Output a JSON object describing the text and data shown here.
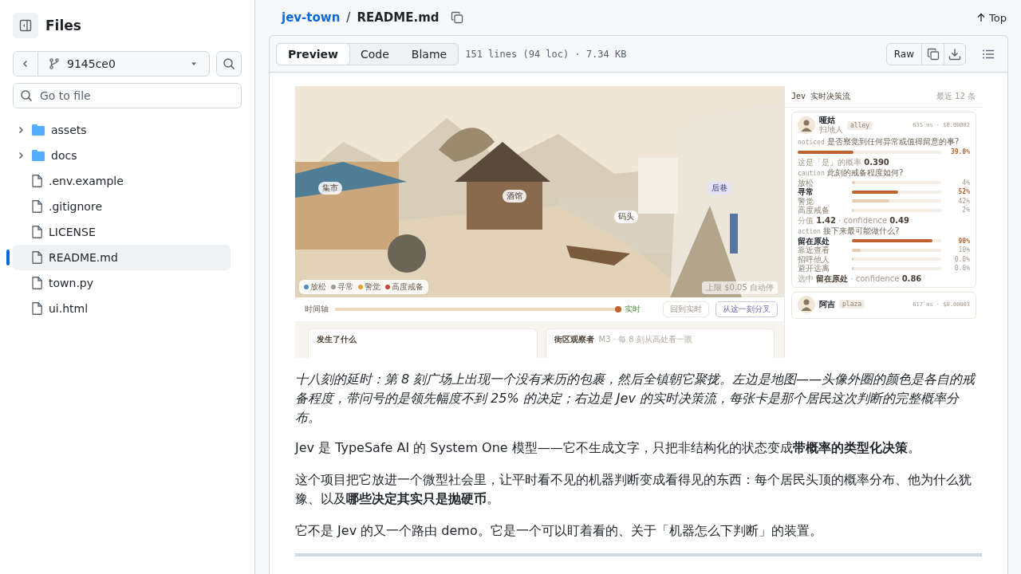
{
  "sidebar": {
    "title": "Files",
    "branch": "9145ce0",
    "search": {
      "placeholder": "Go to file"
    },
    "tree": [
      {
        "kind": "folder",
        "name": "assets",
        "expanded": false,
        "selected": false
      },
      {
        "kind": "folder",
        "name": "docs",
        "expanded": false,
        "selected": false
      },
      {
        "kind": "file",
        "name": ".env.example",
        "selected": false
      },
      {
        "kind": "file",
        "name": ".gitignore",
        "selected": false
      },
      {
        "kind": "file",
        "name": "LICENSE",
        "selected": false
      },
      {
        "kind": "file",
        "name": "README.md",
        "selected": true
      },
      {
        "kind": "file",
        "name": "town.py",
        "selected": false
      },
      {
        "kind": "file",
        "name": "ui.html",
        "selected": false
      }
    ]
  },
  "breadcrumb": {
    "repo": "jev-town",
    "separator": "/",
    "file": "README.md"
  },
  "top_link": "Top",
  "view_tabs": [
    {
      "label": "Preview",
      "selected": true
    },
    {
      "label": "Code",
      "selected": false
    },
    {
      "label": "Blame",
      "selected": false
    }
  ],
  "file_info": "151 lines (94 loc) · 7.34 KB",
  "raw_button": "Raw",
  "readme": {
    "screenshot": {
      "map": {
        "places": [
          {
            "label": "集市",
            "selected": false
          },
          {
            "label": "酒馆",
            "selected": false
          },
          {
            "label": "码头",
            "selected": false
          },
          {
            "label": "后巷",
            "selected": true
          }
        ],
        "legend": [
          {
            "label": "放松",
            "color": "#4a8fc9"
          },
          {
            "label": "寻常",
            "color": "#9c9c9c"
          },
          {
            "label": "警觉",
            "color": "#e0a234"
          },
          {
            "label": "高度戒备",
            "color": "#c9432f"
          }
        ],
        "cap_note": "上限 $0.05 自动停"
      },
      "timeline": {
        "label": "时间轴",
        "level": 1,
        "live_label": "实时",
        "buttons": [
          {
            "label": "回到实时",
            "kind": "plain"
          },
          {
            "label": "从这一刻分叉",
            "kind": "accent"
          }
        ]
      },
      "panels": [
        {
          "title": "发生了什么"
        },
        {
          "title": "街区观察者",
          "subtitle": "M3 · 每 8 刻从高处看一眼"
        }
      ],
      "stream": {
        "title": "Jev 实时决策流",
        "count": "最近 12 条",
        "cards": [
          {
            "name": "哑姑",
            "role": "扫地人",
            "place": "alley",
            "meta": "635 ms · $0.00002",
            "questions": [
              {
                "kind": "binary",
                "key": "noticed",
                "prompt": "是否察觉到任何异常或值得留意的事?",
                "level": 0.39,
                "value": "39.0%",
                "note": "这是「是」的概率 **0.390**"
              },
              {
                "kind": "choice",
                "key": "caution",
                "prompt": "此刻的戒备程度如何?",
                "options": [
                  {
                    "label": "放松",
                    "level": 0.04,
                    "value": "4%",
                    "selected": false
                  },
                  {
                    "label": "寻常",
                    "level": 0.52,
                    "value": "52%",
                    "selected": true
                  },
                  {
                    "label": "警觉",
                    "level": 0.42,
                    "value": "42%",
                    "selected": false
                  },
                  {
                    "label": "高度戒备",
                    "level": 0.02,
                    "value": "2%",
                    "selected": false
                  }
                ],
                "note": "分值 **1.42** · confidence **0.49**"
              },
              {
                "kind": "choice",
                "key": "action",
                "prompt": "接下来最可能做什么?",
                "options": [
                  {
                    "label": "留在原处",
                    "level": 0.9,
                    "value": "90%",
                    "selected": true
                  },
                  {
                    "label": "靠近查看",
                    "level": 0.1,
                    "value": "10%",
                    "selected": false
                  },
                  {
                    "label": "招呼他人",
                    "level": 0.0,
                    "value": "0.0%",
                    "selected": false
                  },
                  {
                    "label": "避开远离",
                    "level": 0.0,
                    "value": "0.0%",
                    "selected": false
                  }
                ],
                "note": "选中 **留在原处** · confidence **0.86**"
              }
            ]
          },
          {
            "name": "阿吉",
            "place": "plaza",
            "meta": "617 ms · $0.00003"
          }
        ]
      }
    },
    "caption": "十八刻的延时：第 8 刻广场上出现一个没有来历的包裹，然后全镇朝它聚拢。左边是地图——头像外圈的颜色是各自的戒备程度，带问号的是领先幅度不到 25% 的决定；右边是 Jev 的实时决策流，每张卡是那个居民这次判断的完整概率分布。",
    "paragraphs": [
      "Jev 是 TypeSafe AI 的 System One 模型——它不生成文字，只把非结构化的状态变成**带概率的类型化决策**。",
      "这个项目把它放进一个微型社会里，让平时看不见的机器判断变成看得见的东西：每个居民头顶的概率分布、他为什么犹豫、以及**哪些决定其实只是抛硬币**。",
      "它不是 Jev 的又一个路由 demo。它是一个可以盯着看的、关于「机器怎么下判断」的装置。"
    ]
  }
}
